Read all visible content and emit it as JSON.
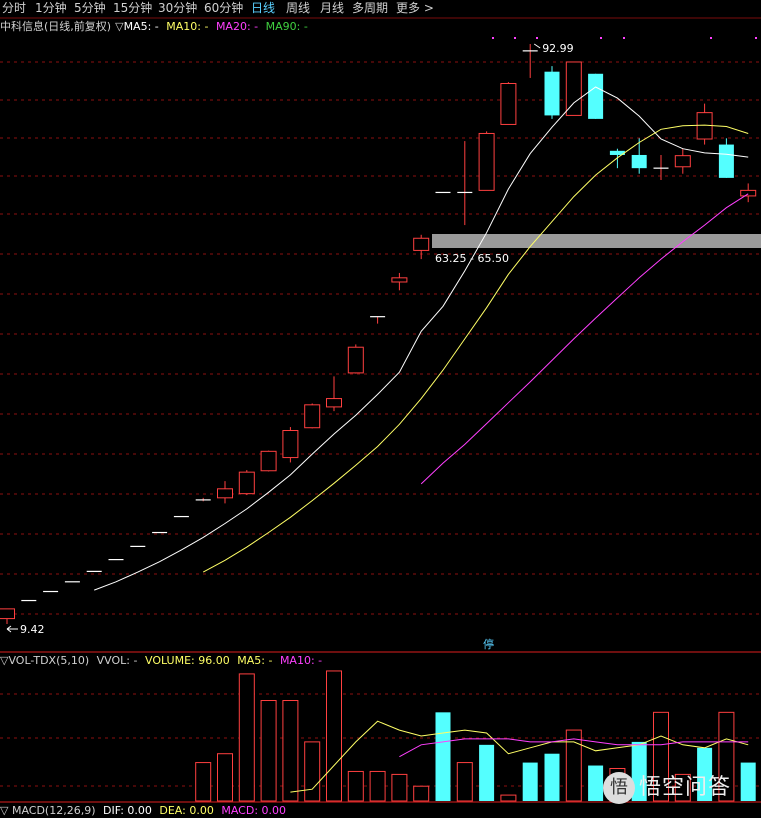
{
  "tabs": [
    "分时",
    "1分钟",
    "5分钟",
    "15分钟",
    "30分钟",
    "60分钟",
    "日线",
    "周线",
    "月线",
    "多周期",
    "更多 >"
  ],
  "active_tab": "日线",
  "main_legend": {
    "stock": "中科信息(日线,前复权)",
    "marker": "▽",
    "ma5": "MA5: -",
    "ma10": "MA10: -",
    "ma20": "MA20: -",
    "ma90": "MA90: -"
  },
  "price_labels": {
    "high": "92.99",
    "low": "9.42",
    "zone": "63.25 - 65.50",
    "halt": "停"
  },
  "vol_legend": {
    "name": "▽VOL-TDX(5,10)",
    "vvol": "VVOL: -",
    "volume": "VOLUME: 96.00",
    "ma5": "MA5: -",
    "ma10": "MA10: -"
  },
  "macd_legend": {
    "name": "▽ MACD(12,26,9)",
    "dif": "DIF: 0.00",
    "dea": "DEA: 0.00",
    "macd": "MACD: 0.00"
  },
  "watermark": {
    "icon": "悟",
    "text": "悟空问答"
  },
  "colors": {
    "up": "#ff4040",
    "down": "#54ffff",
    "ma5": "#ffffff",
    "ma10": "#ffff66",
    "ma20": "#ff40ff",
    "ma90": "#40d040",
    "grid": "#8b1010",
    "tab_active": "#5ad0ff"
  },
  "chart_data": {
    "type": "candlestick",
    "price_range": [
      9.42,
      92.99
    ],
    "candles": [
      {
        "o": 10.2,
        "h": 11.6,
        "l": 9.42,
        "c": 11.6
      },
      {
        "o": 12.8,
        "h": 12.8,
        "l": 12.8,
        "c": 12.8
      },
      {
        "o": 14.1,
        "h": 14.1,
        "l": 14.1,
        "c": 14.1
      },
      {
        "o": 15.5,
        "h": 15.5,
        "l": 15.5,
        "c": 15.5
      },
      {
        "o": 17.0,
        "h": 17.0,
        "l": 17.0,
        "c": 17.0
      },
      {
        "o": 18.7,
        "h": 18.7,
        "l": 18.7,
        "c": 18.7
      },
      {
        "o": 20.6,
        "h": 20.6,
        "l": 20.6,
        "c": 20.6
      },
      {
        "o": 22.6,
        "h": 22.6,
        "l": 22.6,
        "c": 22.6
      },
      {
        "o": 24.9,
        "h": 24.9,
        "l": 24.9,
        "c": 24.9
      },
      {
        "o": 27.3,
        "h": 27.6,
        "l": 27.1,
        "c": 27.3
      },
      {
        "o": 27.6,
        "h": 30.0,
        "l": 26.8,
        "c": 28.9
      },
      {
        "o": 28.2,
        "h": 31.6,
        "l": 28.0,
        "c": 31.3
      },
      {
        "o": 31.5,
        "h": 34.4,
        "l": 31.4,
        "c": 34.3
      },
      {
        "o": 33.4,
        "h": 37.8,
        "l": 32.7,
        "c": 37.3
      },
      {
        "o": 37.7,
        "h": 41.2,
        "l": 37.6,
        "c": 41.0
      },
      {
        "o": 40.7,
        "h": 45.1,
        "l": 40.1,
        "c": 41.9
      },
      {
        "o": 45.6,
        "h": 49.7,
        "l": 45.5,
        "c": 49.3
      },
      {
        "o": 53.7,
        "h": 53.7,
        "l": 52.7,
        "c": 53.7
      },
      {
        "o": 58.7,
        "h": 60.0,
        "l": 57.5,
        "c": 59.3
      },
      {
        "o": 63.25,
        "h": 65.5,
        "l": 62.0,
        "c": 65.0
      },
      {
        "o": 71.6,
        "h": 71.6,
        "l": 71.6,
        "c": 71.6
      },
      {
        "o": 71.6,
        "h": 79.0,
        "l": 66.9,
        "c": 71.6
      },
      {
        "o": 71.9,
        "h": 80.4,
        "l": 71.9,
        "c": 80.1
      },
      {
        "o": 81.4,
        "h": 87.5,
        "l": 81.4,
        "c": 87.3
      },
      {
        "o": 92.0,
        "h": 92.99,
        "l": 88.1,
        "c": 92.0
      },
      {
        "o": 89.0,
        "h": 89.8,
        "l": 82.2,
        "c": 82.7
      },
      {
        "o": 82.7,
        "h": 90.4,
        "l": 82.7,
        "c": 90.4
      },
      {
        "o": 88.7,
        "h": 88.7,
        "l": 82.2,
        "c": 82.2
      },
      {
        "o": 77.6,
        "h": 77.9,
        "l": 75.1,
        "c": 77.0
      },
      {
        "o": 77.0,
        "h": 79.4,
        "l": 74.3,
        "c": 75.1
      },
      {
        "o": 75.1,
        "h": 77.0,
        "l": 73.4,
        "c": 75.1
      },
      {
        "o": 75.3,
        "h": 77.9,
        "l": 74.3,
        "c": 76.9
      },
      {
        "o": 79.3,
        "h": 84.4,
        "l": 78.5,
        "c": 83.1
      },
      {
        "o": 78.5,
        "h": 79.4,
        "l": 73.7,
        "c": 73.7
      },
      {
        "o": 71.1,
        "h": 72.9,
        "l": 70.2,
        "c": 71.9
      }
    ],
    "ma5": [
      null,
      null,
      null,
      null,
      14.3,
      15.5,
      16.9,
      18.4,
      20.1,
      21.9,
      23.9,
      26.0,
      28.4,
      30.9,
      33.9,
      36.8,
      39.5,
      42.5,
      45.7,
      51.6,
      55.2,
      60.3,
      65.8,
      72.1,
      77.2,
      81.0,
      84.5,
      86.8,
      85.2,
      82.6,
      79.3,
      77.9,
      77.3,
      77.1,
      76.7
    ],
    "ma10": [
      null,
      null,
      null,
      null,
      null,
      null,
      null,
      null,
      null,
      16.9,
      18.6,
      20.5,
      22.6,
      24.8,
      27.2,
      29.7,
      32.3,
      35.0,
      38.2,
      41.9,
      46.0,
      50.5,
      55.0,
      59.8,
      63.8,
      67.4,
      71.0,
      74.1,
      76.6,
      78.8,
      80.7,
      81.2,
      81.3,
      81.1,
      80.1
    ],
    "ma20": [
      null,
      null,
      null,
      null,
      null,
      null,
      null,
      null,
      null,
      null,
      null,
      null,
      null,
      null,
      null,
      null,
      null,
      null,
      null,
      29.6,
      32.6,
      35.3,
      38.3,
      41.3,
      44.3,
      47.4,
      50.5,
      53.5,
      56.4,
      59.3,
      62.0,
      64.5,
      66.9,
      69.4,
      71.4
    ],
    "volume": [
      null,
      null,
      null,
      null,
      null,
      null,
      null,
      null,
      null,
      13,
      16,
      43,
      34,
      34,
      20,
      44,
      10,
      10,
      9,
      5,
      30,
      13,
      19,
      2,
      13,
      16,
      24,
      12,
      11,
      20,
      30,
      9,
      18,
      30,
      13
    ],
    "volume_dir": [
      1,
      1,
      1,
      1,
      1,
      1,
      1,
      1,
      1,
      1,
      1,
      1,
      1,
      1,
      1,
      1,
      1,
      1,
      1,
      1,
      -1,
      1,
      -1,
      1,
      -1,
      -1,
      1,
      -1,
      1,
      -1,
      1,
      1,
      -1,
      1,
      -1
    ],
    "vol_ma5": [
      null,
      null,
      null,
      null,
      null,
      null,
      null,
      null,
      null,
      null,
      null,
      null,
      null,
      3,
      4,
      12,
      20,
      27,
      24,
      22,
      23,
      24,
      23,
      16,
      18,
      20,
      20,
      17,
      18,
      19,
      22,
      19,
      18,
      21,
      19
    ],
    "vol_ma10": [
      null,
      null,
      null,
      null,
      null,
      null,
      null,
      null,
      null,
      null,
      null,
      null,
      null,
      null,
      null,
      null,
      null,
      null,
      15,
      19,
      20,
      21,
      21,
      21,
      20,
      20,
      21,
      20,
      19,
      19,
      19,
      20,
      20,
      20,
      20
    ]
  }
}
